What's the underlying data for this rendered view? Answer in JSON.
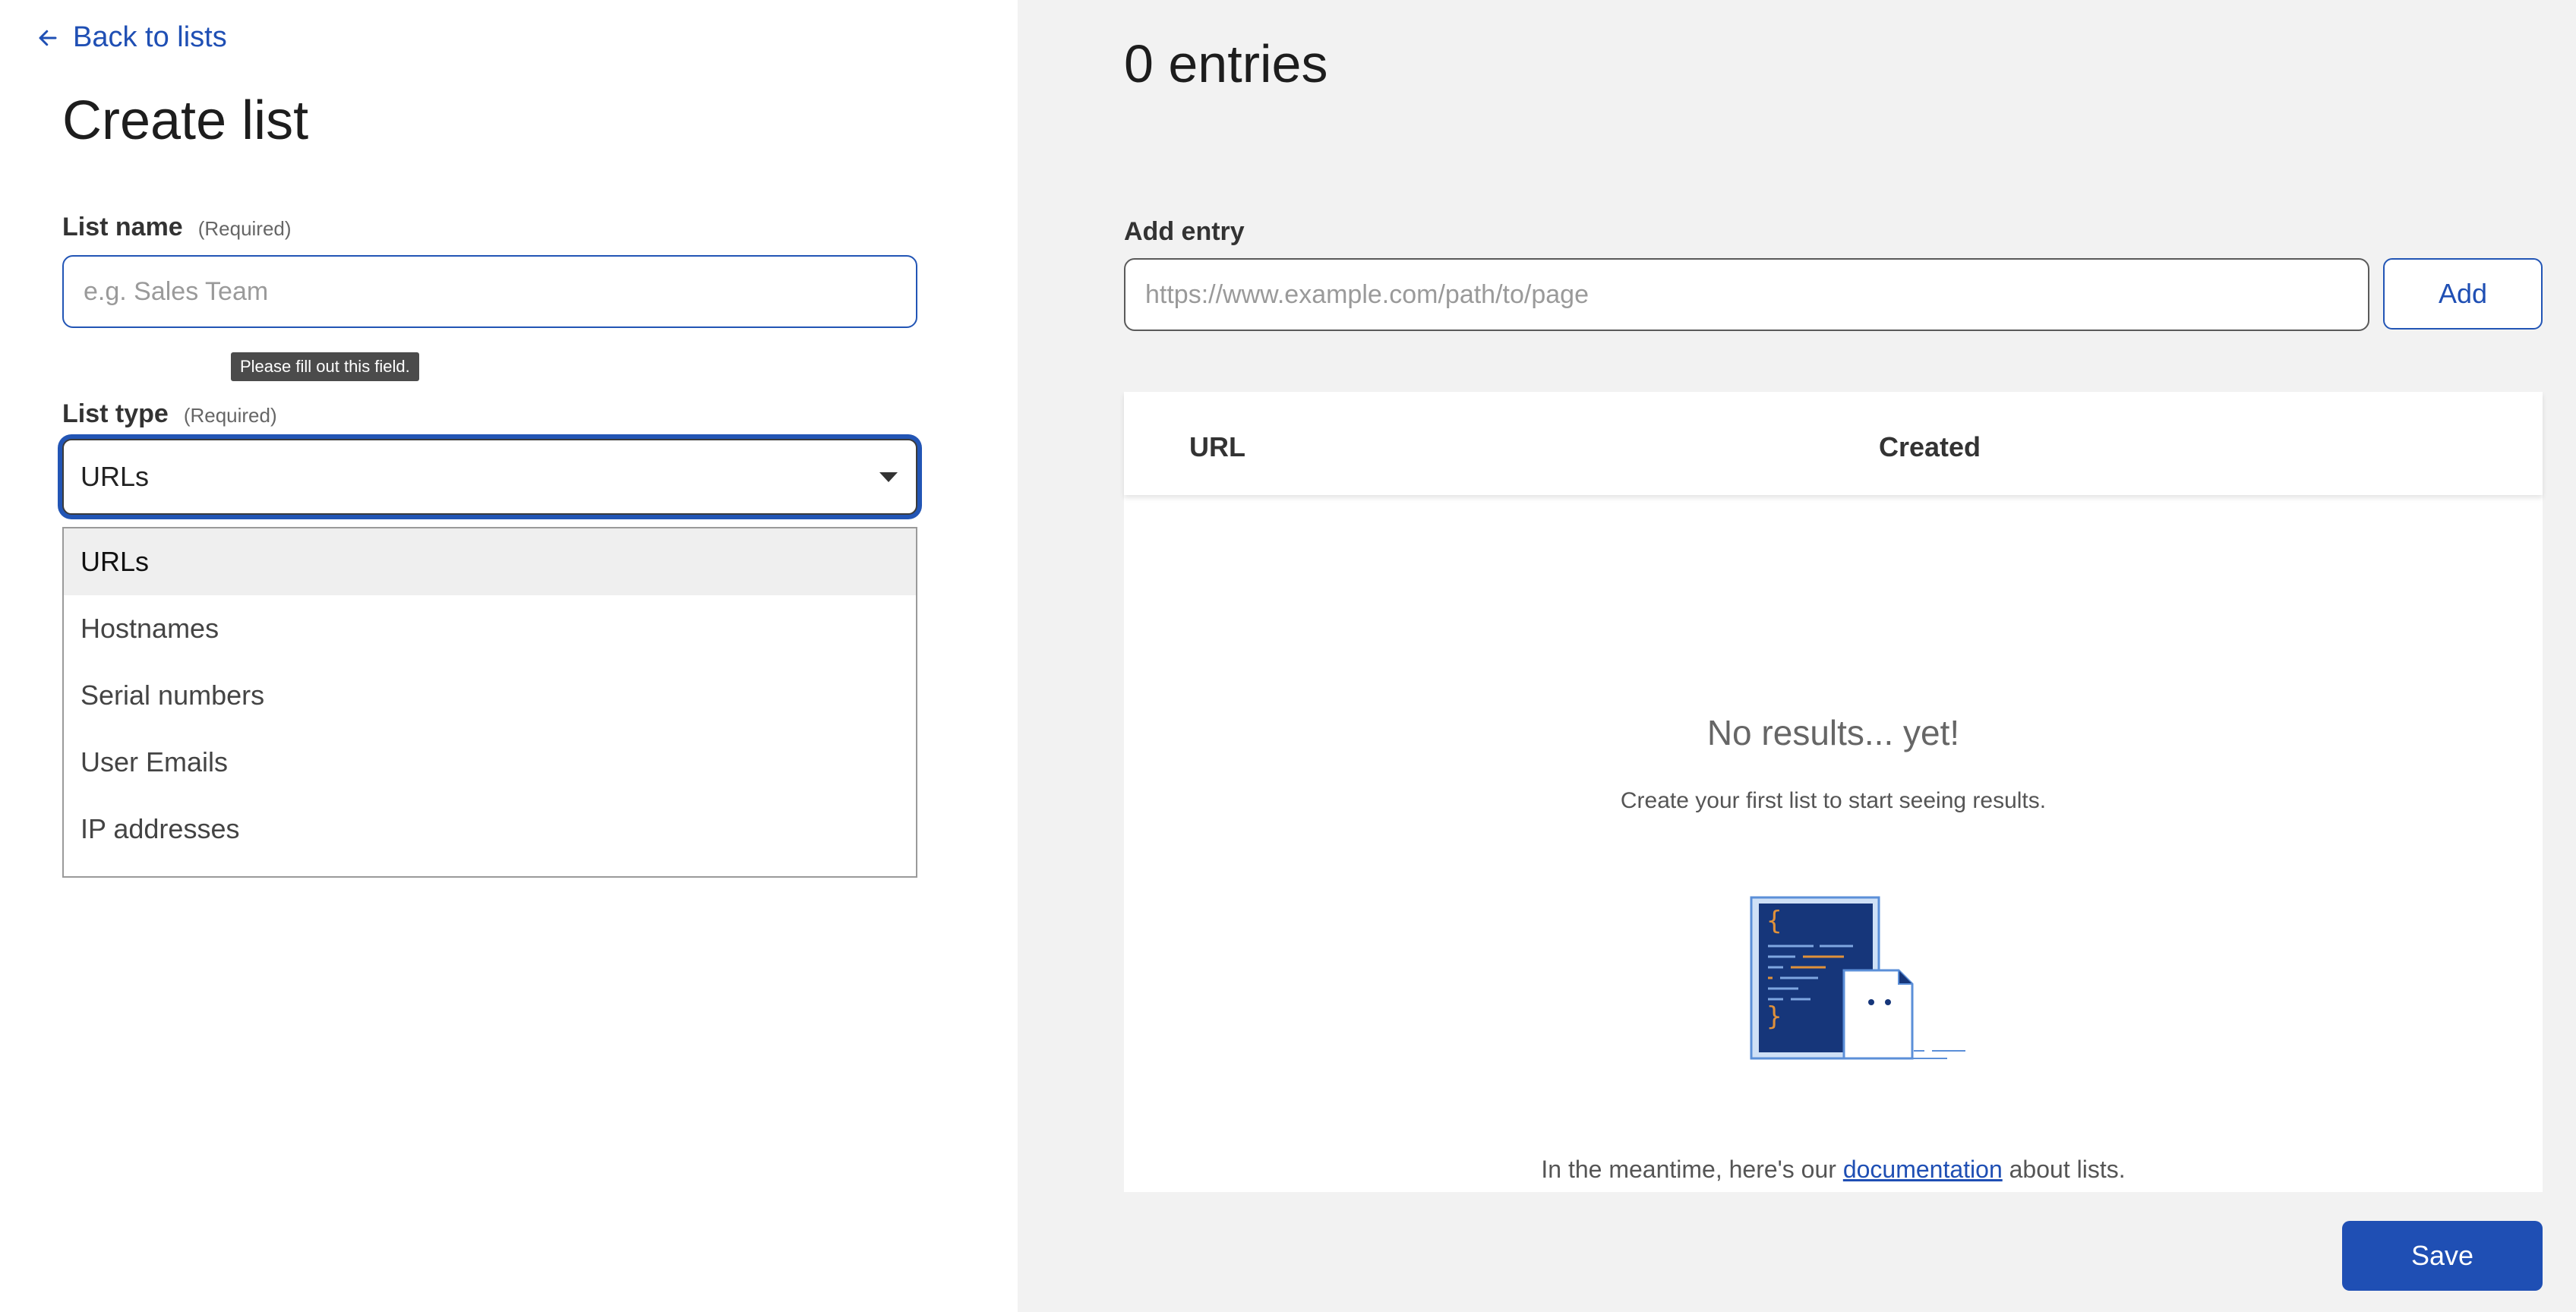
{
  "back_link": "Back to lists",
  "page_title": "Create list",
  "list_name": {
    "label": "List name",
    "required": "(Required)",
    "placeholder": "e.g. Sales Team",
    "value": ""
  },
  "tooltip": "Please fill out this field.",
  "list_type": {
    "label": "List type",
    "required": "(Required)",
    "selected": "URLs",
    "options": [
      "URLs",
      "Hostnames",
      "Serial numbers",
      "User Emails",
      "IP addresses"
    ]
  },
  "entries_count": "0 entries",
  "add_entry": {
    "label": "Add entry",
    "placeholder": "https://www.example.com/path/to/page",
    "button": "Add"
  },
  "table": {
    "columns": [
      "URL",
      "Created"
    ],
    "empty_title": "No results... yet!",
    "empty_subtitle": "Create your first list to start seeing results.",
    "doc_prefix": "In the meantime, here's our ",
    "doc_link": "documentation",
    "doc_suffix": " about lists."
  },
  "save_button": "Save",
  "colors": {
    "accent": "#1f4fb4",
    "illustration_dark": "#16367a",
    "illustration_light": "#cfe0f6",
    "illustration_code": "#e0913a"
  },
  "icons": [
    "arrow-left-icon",
    "caret-down-icon",
    "empty-state-illustration"
  ]
}
